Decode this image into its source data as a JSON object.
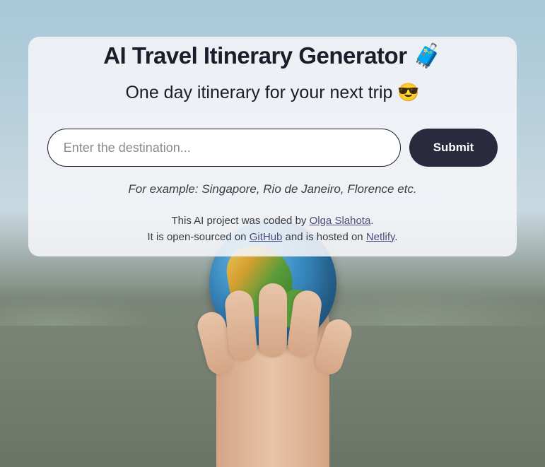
{
  "header": {
    "title": "AI Travel Itinerary Generator 🧳",
    "subtitle": "One day itinerary for your next trip 😎"
  },
  "form": {
    "placeholder": "Enter the destination...",
    "submit_label": "Submit",
    "example_text": "For example: Singapore, Rio de Janeiro, Florence etc."
  },
  "footer": {
    "line1_prefix": "This AI project was coded by ",
    "author": "Olga Slahota",
    "line1_suffix": ".",
    "line2_prefix": "It is open-sourced on ",
    "source_label": "GitHub",
    "line2_mid": " and is hosted on ",
    "host_label": "Netlify",
    "line2_suffix": "."
  }
}
